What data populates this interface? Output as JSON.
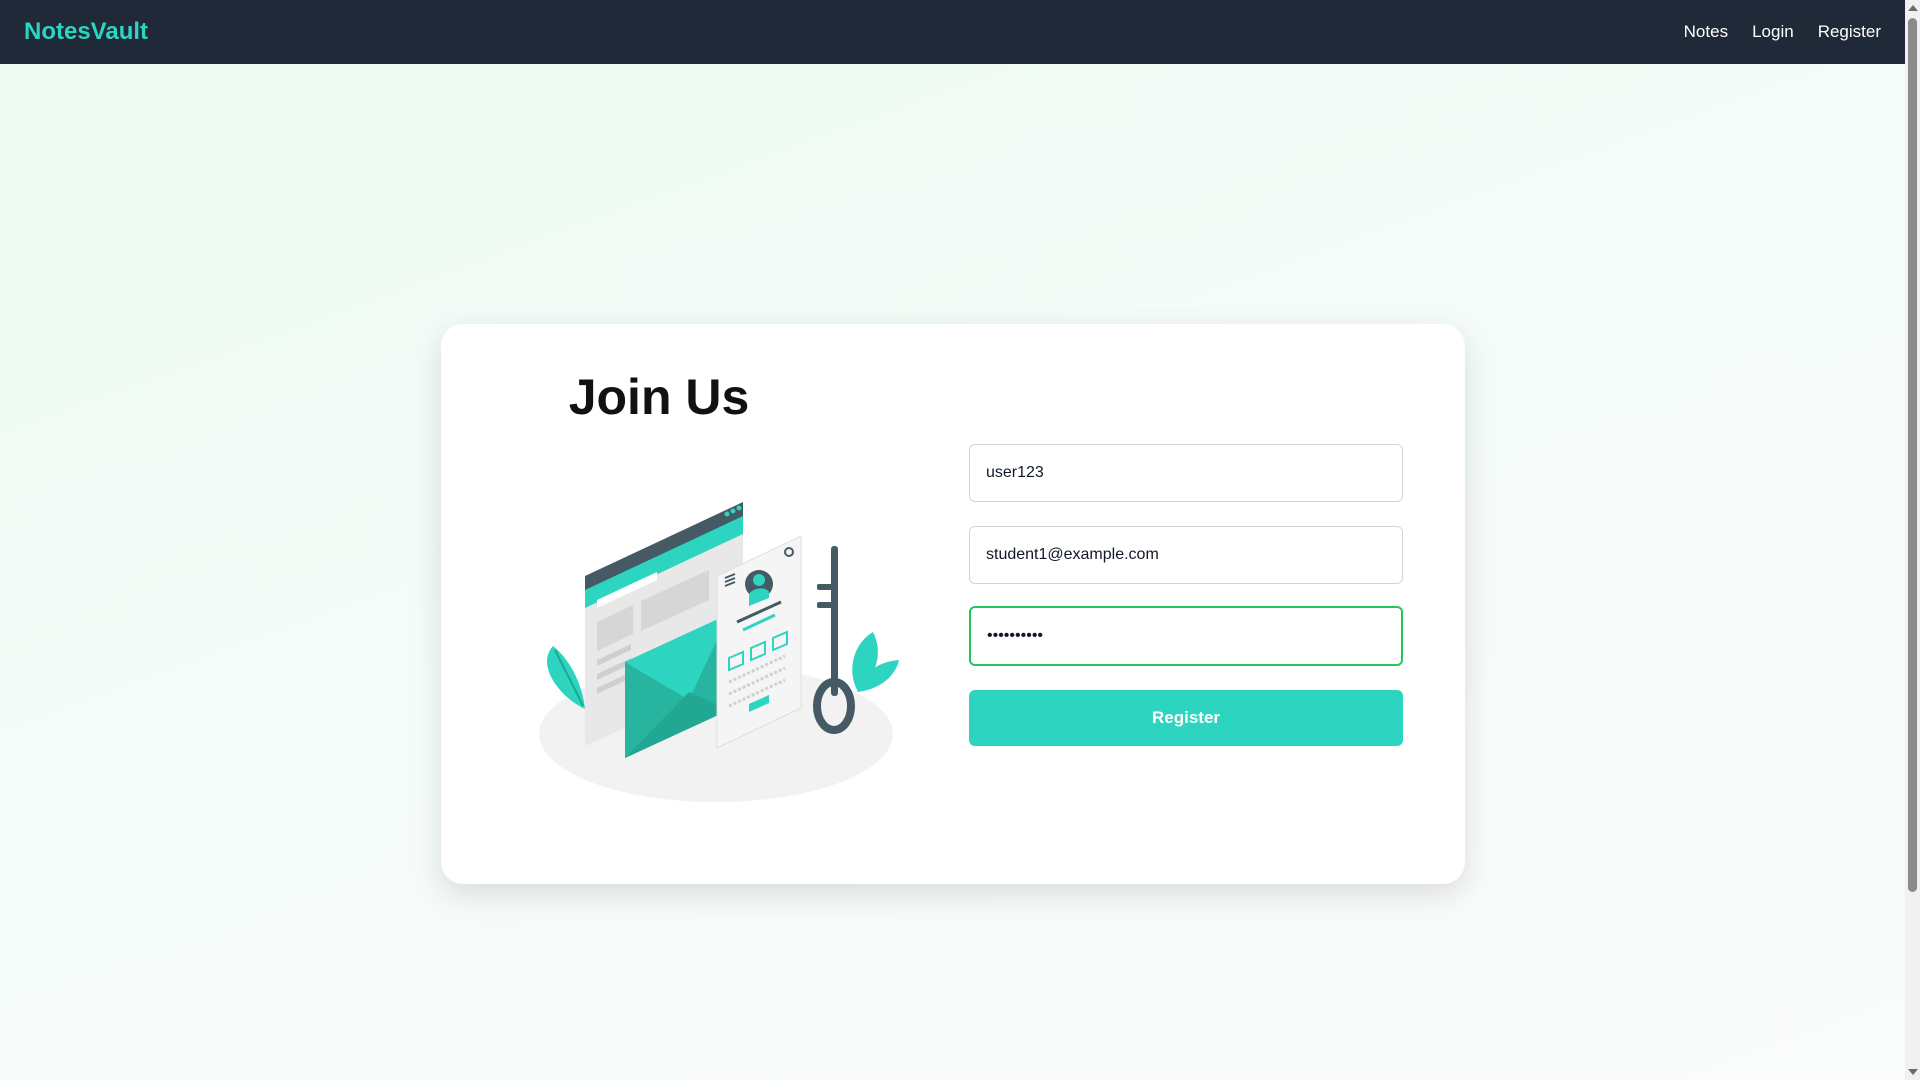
{
  "navbar": {
    "brand": "NotesVault",
    "links": [
      "Notes",
      "Login",
      "Register"
    ]
  },
  "card": {
    "title": "Join Us",
    "illustration": "registration-illustration"
  },
  "form": {
    "username_value": "user123",
    "email_value": "student1@example.com",
    "password_value": "••••••••••",
    "submit_label": "Register"
  },
  "colors": {
    "accent": "#2dd4bf",
    "navbar_bg": "#1f2937",
    "focus_border": "#22c55e"
  }
}
